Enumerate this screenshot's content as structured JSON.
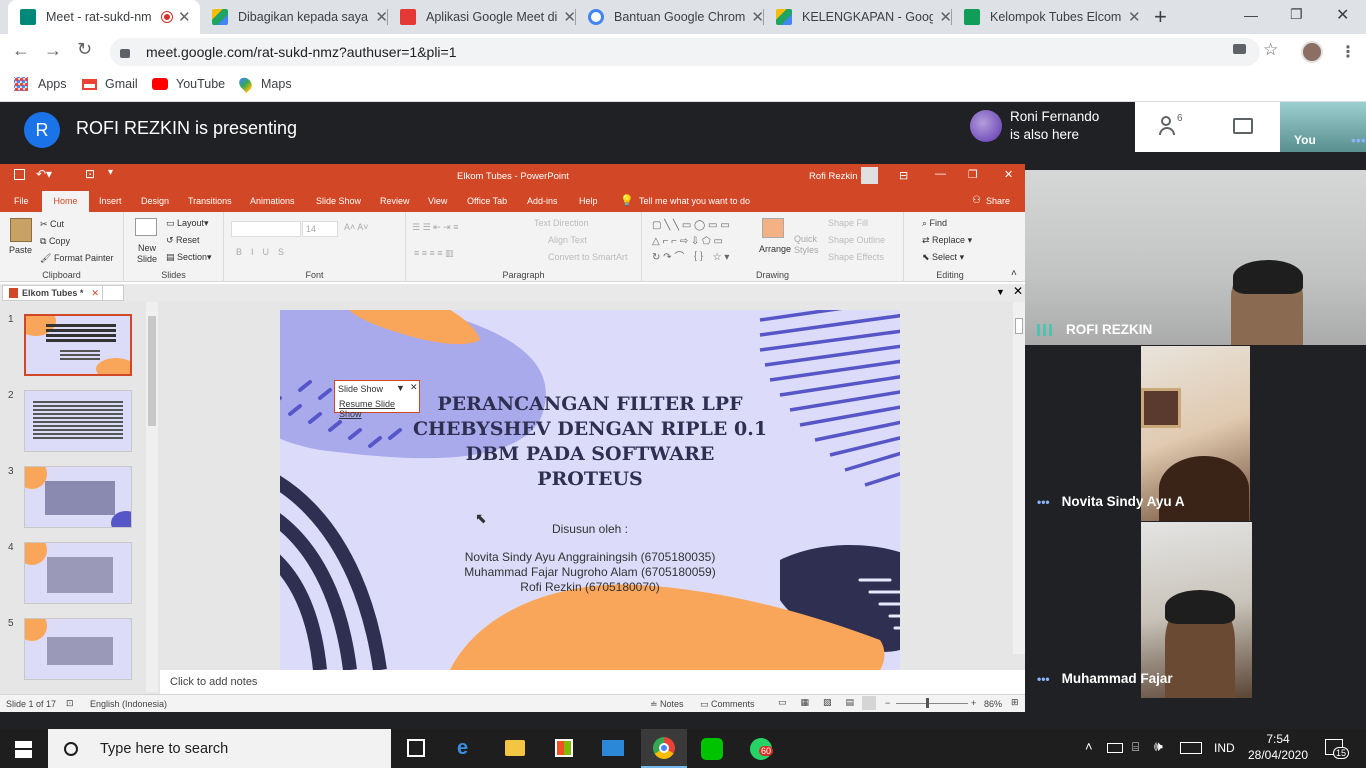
{
  "browser": {
    "tabs": [
      {
        "title": "Meet - rat-sukd-nm",
        "favicon_color": "#00897b"
      },
      {
        "title": "Dibagikan kepada saya",
        "favicon_color": "#1fa463"
      },
      {
        "title": "Aplikasi Google Meet di",
        "favicon_color": "#e53935"
      },
      {
        "title": "Bantuan Google Chrom",
        "favicon_color": "#4285f4"
      },
      {
        "title": "KELENGKAPAN - Googl",
        "favicon_color": "#fbbc04"
      },
      {
        "title": "Kelompok Tubes Elcom",
        "favicon_color": "#0f9d58"
      }
    ],
    "new_tab": "+",
    "window_controls": {
      "minimize": "—",
      "restore": "❐",
      "close": "✕"
    },
    "url": "meet.google.com/rat-sukd-nmz?authuser=1&pli=1",
    "bookmarks": [
      {
        "label": "Apps",
        "icon": "apps-grid-icon"
      },
      {
        "label": "Gmail",
        "icon": "gmail-icon"
      },
      {
        "label": "YouTube",
        "icon": "youtube-icon"
      },
      {
        "label": "Maps",
        "icon": "maps-pin-icon"
      }
    ]
  },
  "meet": {
    "presenter_initial": "R",
    "presenting_text": "ROFI REZKIN is presenting",
    "also_here_name": "Roni Fernando",
    "also_here_text": "is also here",
    "people_count": "6",
    "you_label": "You",
    "participants": [
      {
        "name": "ROFI REZKIN"
      },
      {
        "name": "Novita Sindy Ayu A"
      },
      {
        "name": "Muhammad Fajar"
      }
    ]
  },
  "powerpoint": {
    "title": "Elkom Tubes - PowerPoint",
    "user": "Rofi Rezkin",
    "menu": [
      "File",
      "Home",
      "Insert",
      "Design",
      "Transitions",
      "Animations",
      "Slide Show",
      "Review",
      "View",
      "Office Tab",
      "Add-ins",
      "Help"
    ],
    "tell_me": "Tell me what you want to do",
    "share": "Share",
    "ribbon": {
      "paste": "Paste",
      "cut": "Cut",
      "copy": "Copy",
      "format_painter": "Format Painter",
      "clipboard": "Clipboard",
      "new_slide": "New Slide",
      "layout": "Layout",
      "reset": "Reset",
      "section": "Section",
      "slides": "Slides",
      "font_size": "14",
      "font": "Font",
      "text_direction": "Text Direction",
      "align_text": "Align Text",
      "convert_smartart": "Convert to SmartArt",
      "paragraph": "Paragraph",
      "arrange": "Arrange",
      "quick_styles": "Quick Styles",
      "shape_fill": "Shape Fill",
      "shape_outline": "Shape Outline",
      "shape_effects": "Shape Effects",
      "drawing": "Drawing",
      "find": "Find",
      "replace": "Replace",
      "select": "Select",
      "editing": "Editing"
    },
    "doc_tab": "Elkom Tubes *",
    "slide_numbers": [
      "1",
      "2",
      "3",
      "4",
      "5"
    ],
    "slide": {
      "title_lines": [
        "PERANCANGAN FILTER LPF",
        "CHEBYSHEV DENGAN RIPLE 0.1",
        "DBM PADA SOFTWARE",
        "PROTEUS"
      ],
      "disusun": "Disusun oleh :",
      "authors": [
        "Novita Sindy Ayu Anggrainingsih (6705180035)",
        "Muhammad Fajar Nugroho Alam (6705180059)",
        "Rofi Rezkin (6705180070)"
      ]
    },
    "slideshow_popup": {
      "title": "Slide Show",
      "resume": "Resume Slide Show"
    },
    "notes_placeholder": "Click to add notes",
    "status": {
      "slide_of": "Slide 1 of 17",
      "language": "English (Indonesia)",
      "notes": "Notes",
      "comments": "Comments",
      "zoom": "86%"
    }
  },
  "taskbar": {
    "search_placeholder": "Type here to search",
    "whatsapp_badge": "60",
    "lang": "IND",
    "time": "7:54",
    "date": "28/04/2020",
    "notif_count": "15"
  }
}
